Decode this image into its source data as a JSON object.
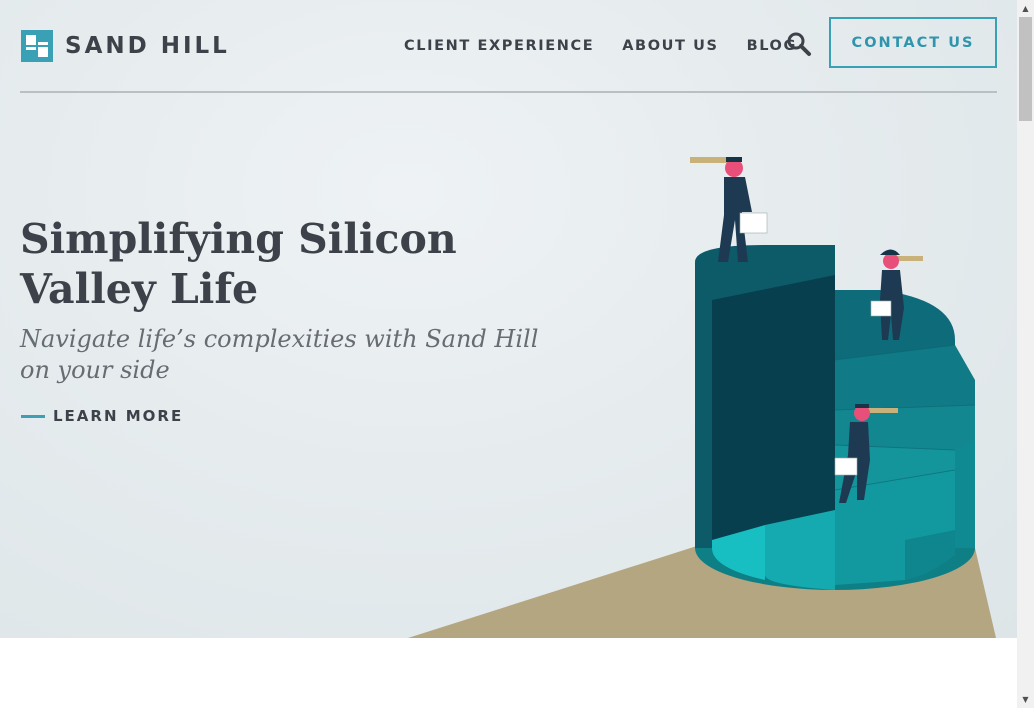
{
  "brand": {
    "name": "SAND HILL",
    "accent": "#3aa0b5",
    "text_color": "#3d414a"
  },
  "nav": {
    "items": [
      {
        "label": "CLIENT EXPERIENCE"
      },
      {
        "label": "ABOUT US"
      },
      {
        "label": "BLOG"
      }
    ],
    "search_icon": "search-icon",
    "contact_label": "CONTACT US"
  },
  "hero": {
    "title": "Simplifying Silicon Valley Life",
    "subtitle": "Navigate life’s complexities with Sand Hill on your side",
    "cta_label": "LEARN MORE",
    "illustration": "spiral-staircase-businesspeople-with-telescopes"
  }
}
